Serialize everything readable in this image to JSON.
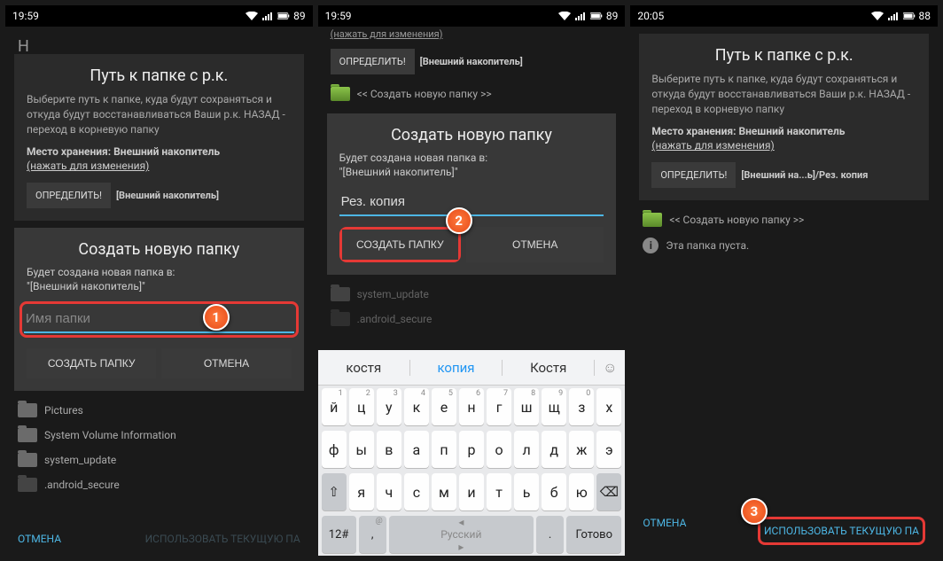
{
  "status": {
    "time1": "19:59",
    "time2": "19:59",
    "time3": "20:05",
    "bat12": "89",
    "bat3": "88"
  },
  "dialog": {
    "title": "Путь к папке с р.к.",
    "desc": "Выберите путь к папке, куда будут сохраняться и откуда будут восстанавливаться Ваши р.к. НАЗАД - переход в корневую папку",
    "storage_label": "Место хранения: Внешний накопитель",
    "change_link": "(нажать для изменения)",
    "define_btn": "ОПРЕДЕЛИТЬ!",
    "path1": "[Внешний накопитель]",
    "path3": "[Внешний на...ь]/Рез. копия"
  },
  "create": {
    "title": "Создать новую папку",
    "subtitle": "Будет создана новая папка в:",
    "loc": "\"[Внешний накопитель]\"",
    "placeholder": "Имя папки",
    "typed": "Рез. копия",
    "create_btn": "СОЗДАТЬ ПАПКУ",
    "cancel_btn": "ОТМЕНА"
  },
  "folders": {
    "new_folder": "<< Создать новую папку >>",
    "pictures": "Pictures",
    "sysvol": "System Volume Information",
    "sysupd": "system_update",
    "andsec": ".android_secure",
    "empty": "Эта папка пуста."
  },
  "bottom": {
    "cancel": "ОТМЕНА",
    "use": "ИСПОЛЬЗОВАТЬ ТЕКУЩУЮ ПА"
  },
  "kb": {
    "sugg": [
      "костя",
      "копия",
      "Костя"
    ],
    "r1sup": [
      "1",
      "2",
      "3",
      "4",
      "5",
      "6",
      "7",
      "8",
      "9",
      "0"
    ],
    "r1": [
      "й",
      "ц",
      "у",
      "к",
      "е",
      "н",
      "г",
      "ш",
      "щ",
      "з",
      "х"
    ],
    "r2": [
      "ф",
      "ы",
      "в",
      "а",
      "п",
      "р",
      "о",
      "л",
      "д",
      "ж",
      "э"
    ],
    "r3": [
      "я",
      "ч",
      "с",
      "м",
      "и",
      "т",
      "ь",
      "б",
      "ю"
    ],
    "numkey": "12#",
    "lang": "Русский",
    "done": "Готово"
  },
  "badges": {
    "b1": "1",
    "b2": "2",
    "b3": "3"
  }
}
